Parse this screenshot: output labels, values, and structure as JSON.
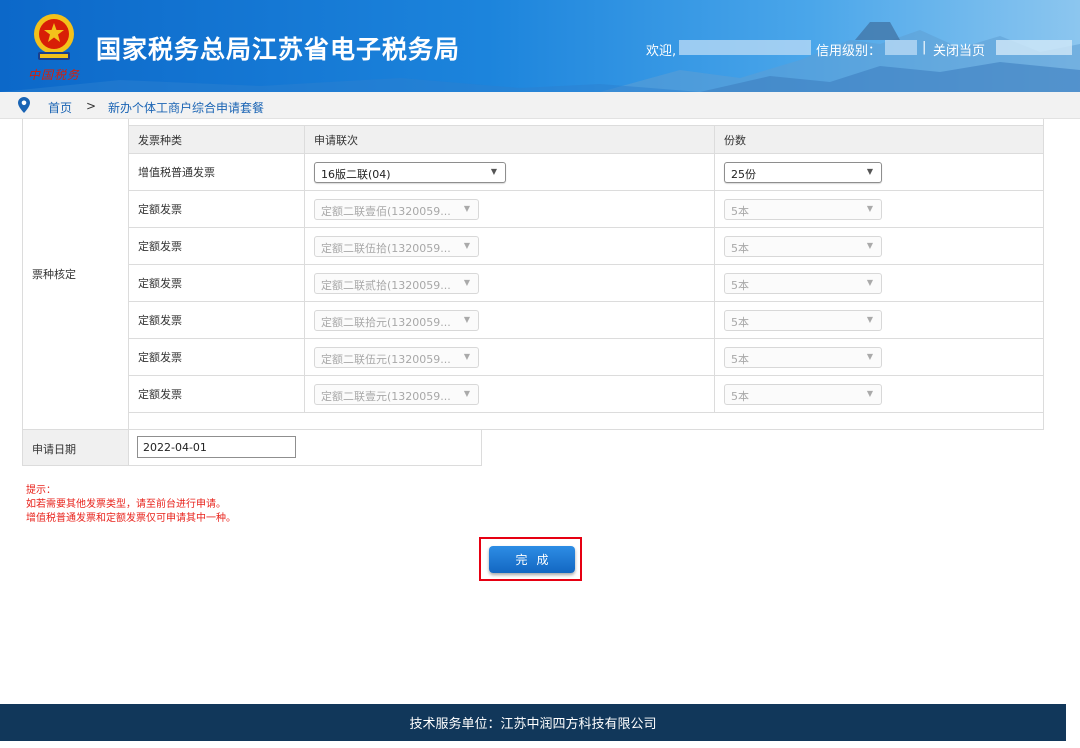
{
  "header": {
    "site_title": "国家税务总局江苏省电子税务局",
    "brand_sub": "中国税务",
    "welcome": "欢迎,",
    "credit_level": "信用级别：",
    "separator": "|",
    "close_page": "关闭当页",
    "colors": {
      "bar_start": "#0c68c9",
      "bar_end": "#8cc6ef",
      "emblem_red": "#d81e06",
      "emblem_gold": "#f3c11b"
    }
  },
  "breadcrumb": {
    "home": "首页",
    "arrow": ">",
    "current": "新办个体工商户综合申请套餐"
  },
  "ticket_section": {
    "label": "票种核定",
    "columns": [
      "发票种类",
      "申请联次",
      "份数"
    ],
    "rows": [
      {
        "type": "增值税普通发票",
        "copy": "16版二联(04)",
        "qty": "25份",
        "enabled": "true"
      },
      {
        "type": "定额发票",
        "copy": "定额二联壹佰(1320059...",
        "qty": "5本",
        "enabled": "false"
      },
      {
        "type": "定额发票",
        "copy": "定额二联伍拾(1320059...",
        "qty": "5本",
        "enabled": "false"
      },
      {
        "type": "定额发票",
        "copy": "定额二联贰拾(1320059...",
        "qty": "5本",
        "enabled": "false"
      },
      {
        "type": "定额发票",
        "copy": "定额二联拾元(1320059...",
        "qty": "5本",
        "enabled": "false"
      },
      {
        "type": "定额发票",
        "copy": "定额二联伍元(1320059...",
        "qty": "5本",
        "enabled": "false"
      },
      {
        "type": "定额发票",
        "copy": "定额二联壹元(1320059...",
        "qty": "5本",
        "enabled": "false"
      }
    ]
  },
  "date_section": {
    "label": "申请日期",
    "value": "2022-04-01"
  },
  "tips": {
    "title": "提示：",
    "line1": "如若需要其他发票类型，请至前台进行申请。",
    "line2": "增值税普通发票和定额发票仅可申请其中一种。",
    "color": "#e8231c"
  },
  "finish_button": {
    "label": "完成"
  },
  "footer": {
    "text": "技术服务单位：江苏中润四方科技有限公司"
  }
}
